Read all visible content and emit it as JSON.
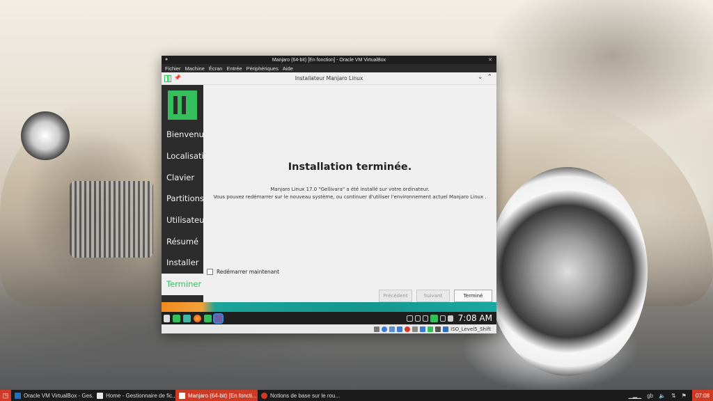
{
  "vbox": {
    "title": "Manjaro (64-bit) [En fonction] - Oracle VM VirtualBox",
    "menu": [
      "Fichier",
      "Machine",
      "Écran",
      "Entrée",
      "Périphériques",
      "Aide"
    ],
    "host_key_label": "ISO_Level5_Shift"
  },
  "installer": {
    "window_title": "Installateur Manjaro Linux",
    "steps": [
      "Bienvenue",
      "Localisation",
      "Clavier",
      "Partitions",
      "Utilisateurs",
      "Résumé",
      "Installer",
      "Terminer"
    ],
    "current_step_index": 7,
    "heading": "Installation terminée.",
    "message_line1": "Manjaro Linux 17.0 \"Gellivara\" a été installé sur votre ordinateur.",
    "message_line2": "Vous pouvez redémarrer sur le nouveau système, ou continuer d'utiliser l'environnement actuel Manjaro Linux .",
    "restart_checkbox_label": "Redémarrer maintenant",
    "restart_checked": false,
    "buttons": {
      "previous": "Précédent",
      "next": "Suivant",
      "finish": "Terminé"
    }
  },
  "guest_taskbar": {
    "clock": "7:08 AM"
  },
  "host_taskbar": {
    "tasks": [
      {
        "label": "Oracle VM VirtualBox - Ges...",
        "active": false,
        "color": "#2a6fb5"
      },
      {
        "label": "Home - Gestionnaire de fic...",
        "active": false,
        "color": "#e8e8e8"
      },
      {
        "label": "Manjaro (64-bit) [En foncti...",
        "active": true,
        "color": "#ffffff"
      },
      {
        "label": "Notions de base sur le rou...",
        "active": false,
        "color": "#d23a28"
      }
    ],
    "keyboard_layout": "gb",
    "clock": "07:08"
  },
  "colors": {
    "manjaro_green": "#35bf5c",
    "accent_red": "#cf3a24",
    "teal": "#14968e"
  }
}
